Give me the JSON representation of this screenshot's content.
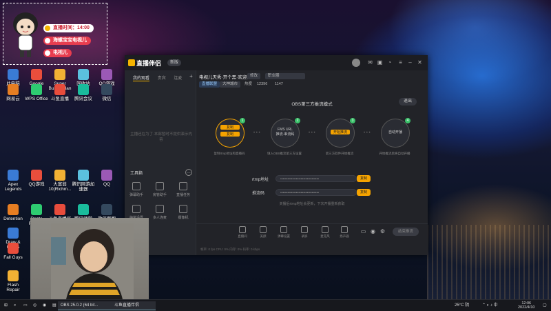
{
  "desktop": {
    "icons": [
      {
        "label": "此电脑"
      },
      {
        "label": "Google"
      },
      {
        "label": "Super Bunny Man"
      },
      {
        "label": "回收站"
      },
      {
        "label": "QQ游戏"
      },
      {
        "label": "网易云"
      },
      {
        "label": "WPS Office"
      },
      {
        "label": "斗鱼直播"
      },
      {
        "label": "腾讯会议"
      },
      {
        "label": "微信"
      },
      {
        "label": "Apex Legends"
      },
      {
        "label": "QQ游戏"
      },
      {
        "label": "大富翁10(Richm..."
      },
      {
        "label": "腾讯网游加速器"
      },
      {
        "label": "QQ"
      },
      {
        "label": "Detention"
      },
      {
        "label": "Rento Fortune"
      },
      {
        "label": "斗鱼直播伴侣"
      },
      {
        "label": "腾讯课堂"
      },
      {
        "label": "微信截图_20200611..."
      },
      {
        "label": "Draw & Guess"
      },
      {
        "label": "Fall Guys"
      },
      {
        "label": "Flash Repair"
      }
    ]
  },
  "overlay": {
    "pill1": "直播时间：14:00",
    "pill2": "海螺宝宝电视儿",
    "pill3": "电视儿"
  },
  "app": {
    "logo": "直播伴侣",
    "version": "新版",
    "sidebar": {
      "tabs": [
        "我的观看",
        "贵宾",
        "连麦"
      ],
      "empty_text": "主播还在为了·本部暂时不提供演示内容",
      "tools_title": "工具箱",
      "tools": [
        "弹幕助手",
        "房管助手",
        "直播任务",
        "抽奖设置",
        "多人连麦",
        "摄像机"
      ]
    },
    "room": {
      "title": "电视儿天秀·开个黑·欢迎来",
      "chip1": "修改",
      "chip2": "职业圈",
      "category": "直播联盟",
      "tag": "大神城市",
      "stat_label": "热度",
      "stat_value": "12396",
      "fans": "1147"
    },
    "mode_title": "OBS第三方推流模式",
    "exit_label": "退出",
    "steps": [
      {
        "num": "1",
        "text": "复制",
        "desc": "复制rtmp地址和直播码"
      },
      {
        "num": "2",
        "text": "FMS URL 推流·串流码",
        "desc": "填入OBS推流第三方设置"
      },
      {
        "num": "3",
        "text": "开始推流",
        "desc": "第三方软件开始推流"
      },
      {
        "num": "4",
        "text": "自动开播",
        "desc": "开始推流后将自动开播"
      }
    ],
    "rtmp_label": "rtmp地址",
    "rtmp_value": "••••••••••••••••••••••••••••••••",
    "code_label": "推流码",
    "code_value": "••••••••••••••••••••••••••••••••",
    "copy_label": "复制",
    "hint": "关播后rtmp地址会更新，下次开播重新获取",
    "bottom_items": [
      "直播间",
      "美颜",
      "弹幕设置",
      "录屏",
      "麦克风",
      "扬声器"
    ],
    "start_label": "结束推流",
    "status": "帧率: 0 fps  CPU: 0%  内存: 0%  码率: 0 kbps"
  },
  "taskbar": {
    "items": [
      "OBS 25.0.2 (64 bit...",
      "斗鱼直播伴侣"
    ],
    "weather": "25°C 阴",
    "time": "12:06",
    "date": "2022/4/10"
  }
}
